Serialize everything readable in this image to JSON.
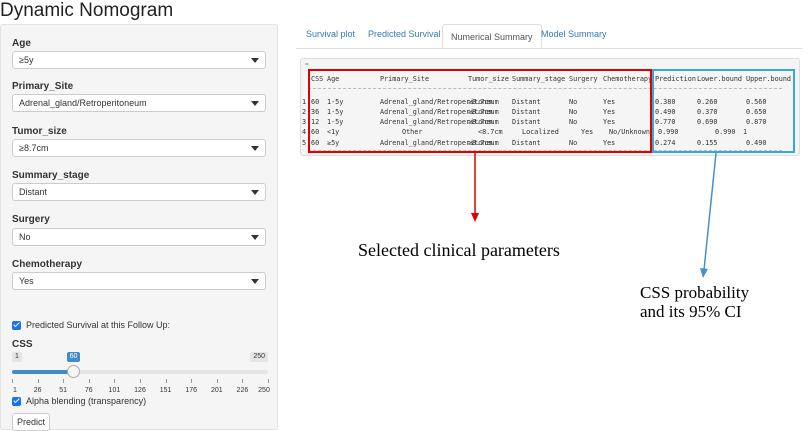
{
  "app_title": "Dynamic Nomogram",
  "sidebar": {
    "fields": [
      {
        "label": "Age",
        "value": "≥5y"
      },
      {
        "label": "Primary_Site",
        "value": "Adrenal_gland/Retroperitoneum"
      },
      {
        "label": "Tumor_size",
        "value": "≥8.7cm"
      },
      {
        "label": "Summary_stage",
        "value": "Distant"
      },
      {
        "label": "Surgery",
        "value": "No"
      },
      {
        "label": "Chemotherapy",
        "value": "Yes"
      }
    ],
    "predicted_checkbox": "Predicted Survival at this Follow Up:",
    "slider": {
      "label": "CSS",
      "min": 1,
      "max": 250,
      "value": 60,
      "ticks": [
        "1",
        "26",
        "51",
        "76",
        "101",
        "126",
        "151",
        "176",
        "201",
        "226",
        "250"
      ]
    },
    "alpha_checkbox": "Alpha blending (transparency)",
    "predict_button": "Predict"
  },
  "tabs": [
    "Survival plot",
    "Predicted Survival",
    "Numerical Summary",
    "Model Summary"
  ],
  "active_tab": "Numerical Summary",
  "table": {
    "prefix": "=",
    "headers": [
      "CSS",
      "Age",
      "Primary_Site",
      "Tumor_size",
      "Summary_stage",
      "Surgery",
      "Chemotherapy",
      "Prediction",
      "Lower.bound",
      "Upper.bound"
    ],
    "rows": [
      {
        "idx": "1",
        "cells": [
          "60",
          "1-5y",
          "Adrenal_gland/Retroperitoneum",
          "≥8.7cm",
          "Distant",
          "No",
          "Yes",
          "0.380",
          "0.260",
          "0.560"
        ]
      },
      {
        "idx": "2",
        "cells": [
          "36",
          "1-5y",
          "Adrenal_gland/Retroperitoneum",
          "≥8.7cm",
          "Distant",
          "No",
          "Yes",
          "0.490",
          "0.370",
          "0.650"
        ]
      },
      {
        "idx": "3",
        "cells": [
          "12",
          "1-5y",
          "Adrenal_gland/Retroperitoneum",
          "≥8.7cm",
          "Distant",
          "No",
          "Yes",
          "0.770",
          "0.690",
          "0.870"
        ]
      },
      {
        "idx": "4",
        "cells": [
          "60",
          "<1y",
          "Other",
          "<8.7cm",
          "Localized",
          "Yes",
          "No/Unknown",
          "0.990",
          "0.990",
          "1"
        ]
      },
      {
        "idx": "5",
        "cells": [
          "60",
          "≥5y",
          "Adrenal_gland/Retroperitoneum",
          "≥8.7cm",
          "Distant",
          "No",
          "Yes",
          "0.274",
          "0.155",
          "0.490"
        ]
      }
    ]
  },
  "annotations": {
    "red": "Selected clinical parameters",
    "blue_line1": "CSS probability",
    "blue_line2": "and its 95% CI"
  },
  "colors": {
    "red_box": "#e00000",
    "blue_box": "#33aadd",
    "slider": "#428bca"
  }
}
